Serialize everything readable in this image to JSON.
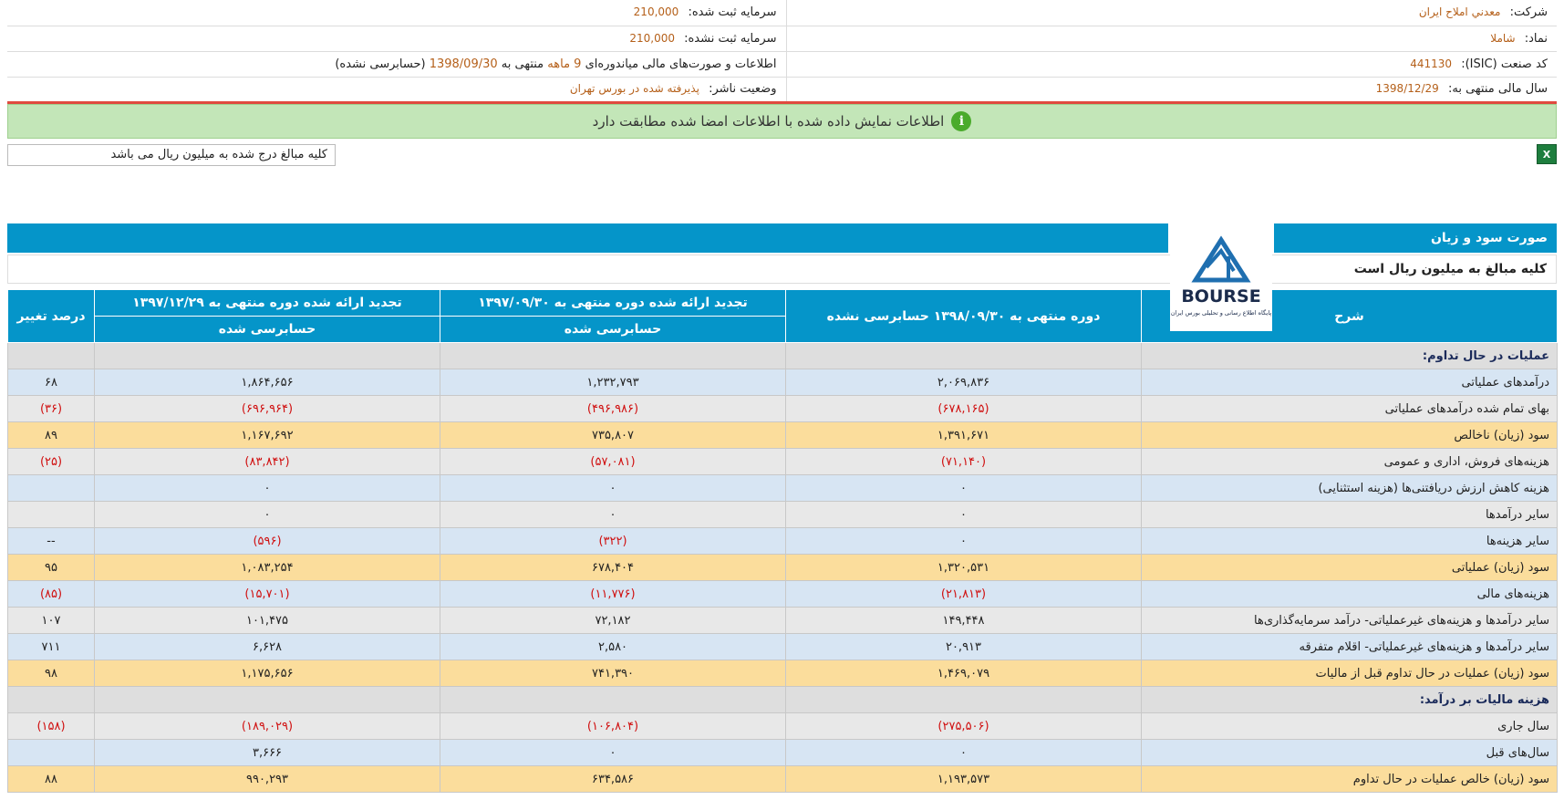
{
  "header": {
    "company_label": "شرکت:",
    "company_value": "معدني املاح ايران",
    "symbol_label": "نماد:",
    "symbol_value": "شاملا",
    "isic_label": "کد صنعت (ISIC):",
    "isic_value": "441130",
    "fiscal_label": "سال مالی منتهی به:",
    "fiscal_value": "1398/12/29",
    "reg_capital_label": "سرمایه ثبت شده:",
    "reg_capital_value": "210,000",
    "unreg_capital_label": "سرمایه ثبت نشده:",
    "unreg_capital_value": "210,000",
    "report_prefix": "اطلاعات و صورت‌های مالی میاندوره‌ای",
    "report_months": "9 ماهه",
    "report_mid": "منتهی به",
    "report_date": "1398/09/30",
    "report_suffix": "(حسابرسی نشده)",
    "publisher_label": "وضعیت ناشر:",
    "publisher_value": "پذیرفته شده در بورس تهران"
  },
  "banner": {
    "icon": "info-icon",
    "text": "اطلاعات نمایش داده شده با اطلاعات امضا شده مطابقت دارد"
  },
  "unit_note": "کلیه مبالغ درج شده به میلیون ریال می باشد",
  "statement": {
    "title": "صورت سود و زیان",
    "subtitle": "کلیه مبالغ به میلیون ریال است",
    "logo_text": "BOURSE",
    "logo_caption": "پایگاه اطلاع رسانی و تحلیلی بورس ایران",
    "columns": {
      "desc": "شرح",
      "period1": "دوره منتهی به ۱۳۹۸/۰۹/۳۰ حسابرسی نشده",
      "period2": "تجدید ارائه شده دوره منتهی به ۱۳۹۷/۰۹/۳۰",
      "period2_sub": "حسابرسی شده",
      "period3": "تجدید ارائه شده دوره منتهی به ۱۳۹۷/۱۲/۲۹",
      "period3_sub": "حسابرسی شده",
      "change": "درصد تغییر"
    },
    "rows": [
      {
        "style": "section",
        "desc": "عملیات در حال تداوم:",
        "p1": "",
        "p2": "",
        "p3": "",
        "chg": ""
      },
      {
        "style": "blue",
        "desc": "درآمدهای عملیاتی",
        "p1": "۲,۰۶۹,۸۳۶",
        "p2": "۱,۲۳۲,۷۹۳",
        "p3": "۱,۸۶۴,۶۵۶",
        "chg": "۶۸"
      },
      {
        "style": "gray",
        "desc": "بهای تمام شده درآمدهای عملیاتی",
        "p1": "(۶۷۸,۱۶۵)",
        "p2": "(۴۹۶,۹۸۶)",
        "p3": "(۶۹۶,۹۶۴)",
        "chg": "(۳۶)"
      },
      {
        "style": "yellow",
        "desc": "سود (زیان) ناخالص",
        "p1": "۱,۳۹۱,۶۷۱",
        "p2": "۷۳۵,۸۰۷",
        "p3": "۱,۱۶۷,۶۹۲",
        "chg": "۸۹"
      },
      {
        "style": "gray",
        "desc": "هزینه‌های فروش، اداری و عمومی",
        "p1": "(۷۱,۱۴۰)",
        "p2": "(۵۷,۰۸۱)",
        "p3": "(۸۳,۸۴۲)",
        "chg": "(۲۵)"
      },
      {
        "style": "blue",
        "desc": "هزینه کاهش ارزش دریافتنی‌ها (هزینه استثنایی)",
        "p1": "۰",
        "p2": "۰",
        "p3": "۰",
        "chg": ""
      },
      {
        "style": "gray",
        "desc": "سایر درآمدها",
        "p1": "۰",
        "p2": "۰",
        "p3": "۰",
        "chg": ""
      },
      {
        "style": "blue",
        "desc": "سایر هزینه‌ها",
        "p1": "۰",
        "p2": "(۳۲۲)",
        "p3": "(۵۹۶)",
        "chg": "--"
      },
      {
        "style": "yellow",
        "desc": "سود (زیان) عملیاتی",
        "p1": "۱,۳۲۰,۵۳۱",
        "p2": "۶۷۸,۴۰۴",
        "p3": "۱,۰۸۳,۲۵۴",
        "chg": "۹۵"
      },
      {
        "style": "blue",
        "desc": "هزینه‌های مالی",
        "p1": "(۲۱,۸۱۳)",
        "p2": "(۱۱,۷۷۶)",
        "p3": "(۱۵,۷۰۱)",
        "chg": "(۸۵)"
      },
      {
        "style": "gray",
        "desc": "سایر درآمدها و هزینه‌های غیرعملیاتی- درآمد سرمایه‌گذاری‌ها",
        "p1": "۱۴۹,۴۴۸",
        "p2": "۷۲,۱۸۲",
        "p3": "۱۰۱,۴۷۵",
        "chg": "۱۰۷"
      },
      {
        "style": "blue",
        "desc": "سایر درآمدها و هزینه‌های غیرعملیاتی- اقلام متفرقه",
        "p1": "۲۰,۹۱۳",
        "p2": "۲,۵۸۰",
        "p3": "۶,۶۲۸",
        "chg": "۷۱۱"
      },
      {
        "style": "yellow",
        "desc": "سود (زیان) عملیات در حال تداوم قبل از مالیات",
        "p1": "۱,۴۶۹,۰۷۹",
        "p2": "۷۴۱,۳۹۰",
        "p3": "۱,۱۷۵,۶۵۶",
        "chg": "۹۸"
      },
      {
        "style": "section",
        "desc": "هزینه مالیات بر درآمد:",
        "p1": "",
        "p2": "",
        "p3": "",
        "chg": ""
      },
      {
        "style": "gray",
        "desc": "سال جاری",
        "p1": "(۲۷۵,۵۰۶)",
        "p2": "(۱۰۶,۸۰۴)",
        "p3": "(۱۸۹,۰۲۹)",
        "chg": "(۱۵۸)"
      },
      {
        "style": "blue",
        "desc": "سال‌های قبل",
        "p1": "۰",
        "p2": "۰",
        "p3": "۳,۶۶۶",
        "chg": ""
      },
      {
        "style": "yellow",
        "desc": "سود (زیان) خالص عملیات در حال تداوم",
        "p1": "۱,۱۹۳,۵۷۳",
        "p2": "۶۳۴,۵۸۶",
        "p3": "۹۹۰,۲۹۳",
        "chg": "۸۸"
      }
    ]
  }
}
